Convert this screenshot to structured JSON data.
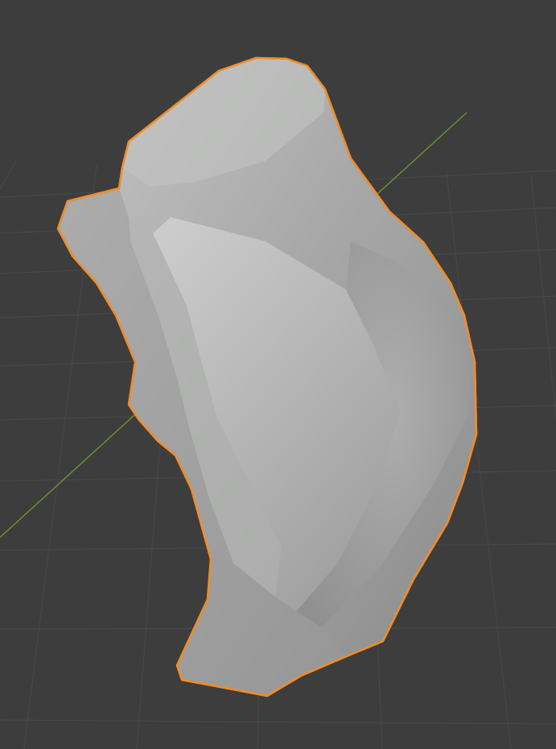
{
  "viewport": {
    "background": "#3d3d3d",
    "grid_color": "#4a4a4a",
    "axis_color": "#6d8f2e",
    "selection_outline_color": "#f08c2a",
    "mesh_base_color": "#a9aaa9",
    "object_selected": true,
    "shading_mode": "solid"
  }
}
